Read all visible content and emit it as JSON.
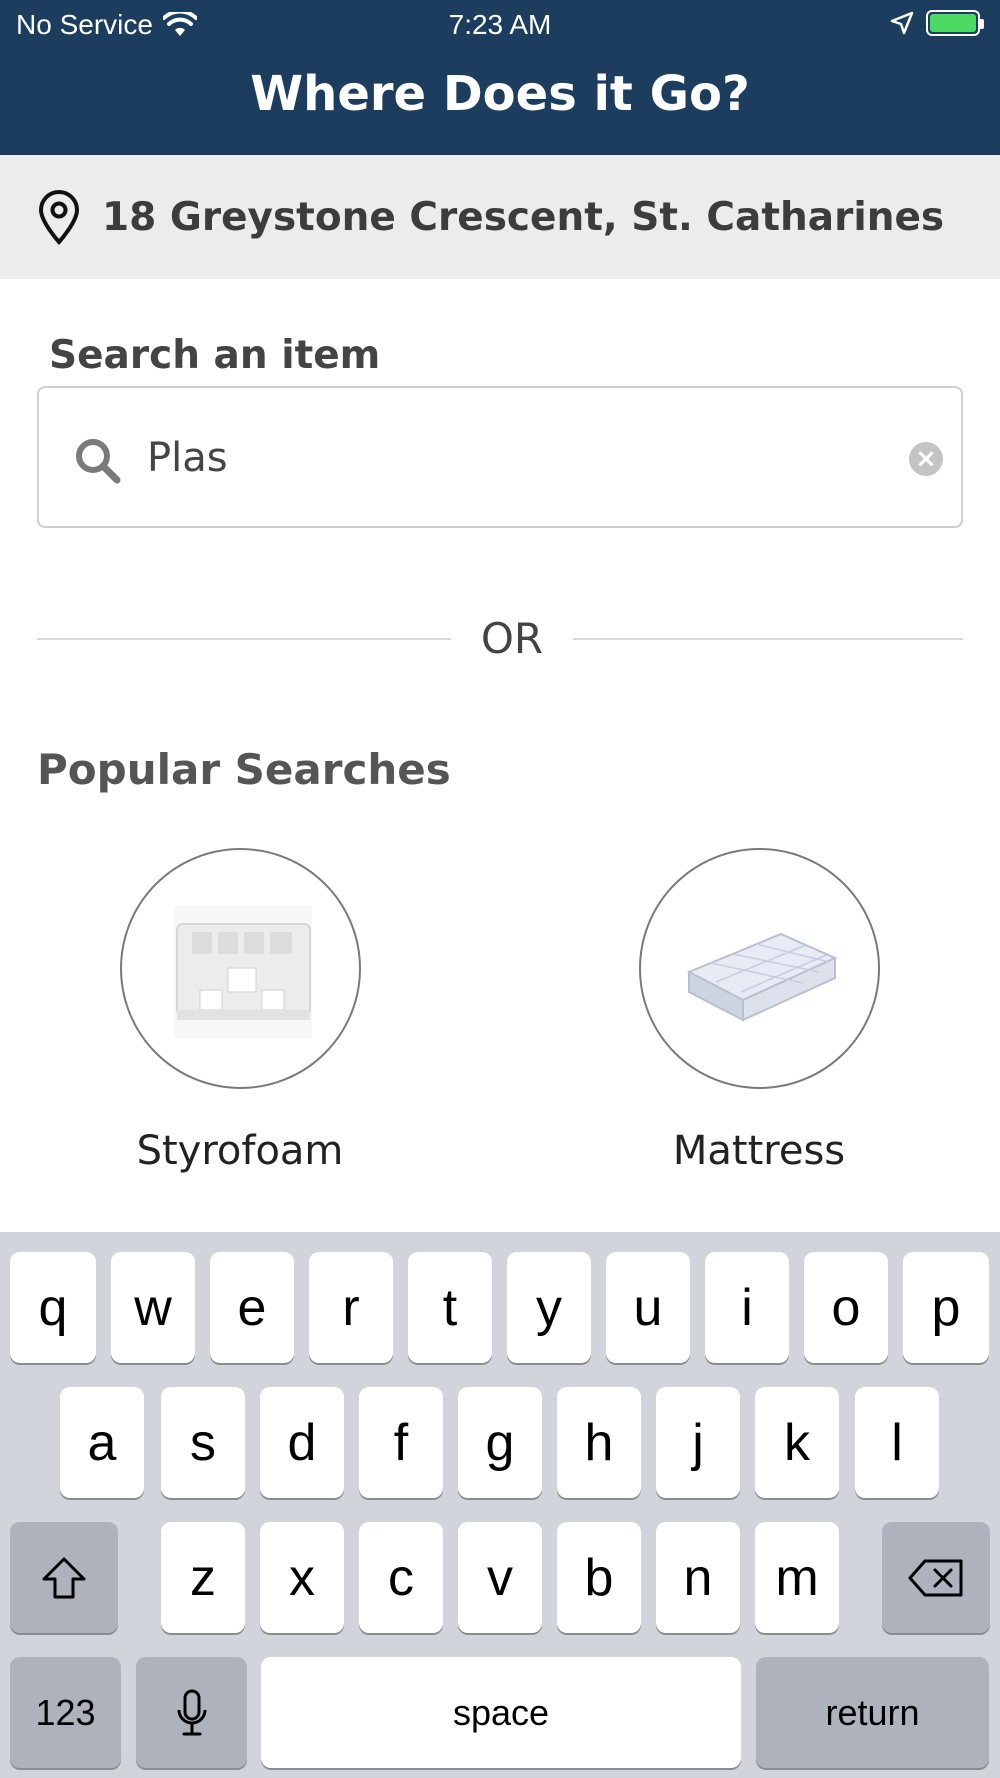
{
  "status_bar": {
    "carrier": "No Service",
    "time": "7:23 AM",
    "icons": [
      "wifi-icon",
      "location-arrow-icon",
      "battery-charging-icon"
    ]
  },
  "header": {
    "title": "Where Does it Go?"
  },
  "location": {
    "address": "18 Greystone Crescent, St. Catharines",
    "icon": "map-pin-icon"
  },
  "search": {
    "label": "Search an item",
    "value": "Plas",
    "icon": "search-icon",
    "clear_icon": "clear-icon"
  },
  "divider": {
    "text": "OR"
  },
  "popular": {
    "title": "Popular Searches",
    "items": [
      {
        "label": "Styrofoam",
        "image": "styrofoam-image"
      },
      {
        "label": "Mattress",
        "image": "mattress-image"
      }
    ]
  },
  "keyboard": {
    "row1": [
      "q",
      "w",
      "e",
      "r",
      "t",
      "y",
      "u",
      "i",
      "o",
      "p"
    ],
    "row2": [
      "a",
      "s",
      "d",
      "f",
      "g",
      "h",
      "j",
      "k",
      "l"
    ],
    "row3": [
      "z",
      "x",
      "c",
      "v",
      "b",
      "n",
      "m"
    ],
    "numbers_label": "123",
    "space_label": "space",
    "return_label": "return"
  },
  "colors": {
    "header_bg": "#1c3d5e",
    "location_bg": "#ececec",
    "keyboard_bg": "#d1d4da"
  }
}
